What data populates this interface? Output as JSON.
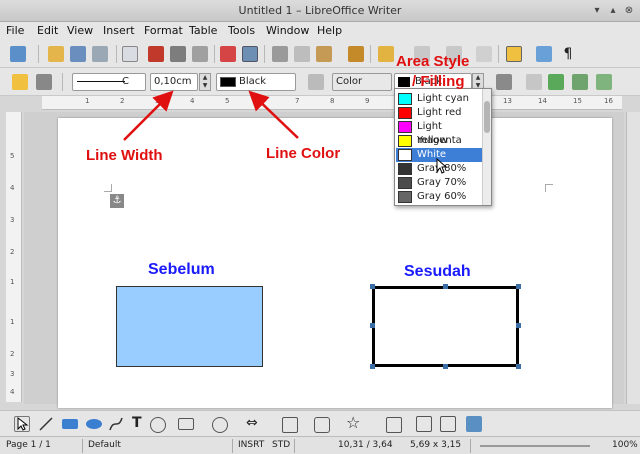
{
  "window": {
    "title": "Untitled 1 – LibreOffice Writer",
    "close_glyph": "⊗"
  },
  "menu": [
    "File",
    "Edit",
    "View",
    "Insert",
    "Format",
    "Table",
    "Tools",
    "Window",
    "Help"
  ],
  "line_toolbar": {
    "line_style_partial": "C",
    "line_width": "0,10cm",
    "line_color": "Black",
    "line_color_swatch": "#000000",
    "area_style": "Color",
    "area_fill": "Black"
  },
  "area_fill_dropdown": {
    "items": [
      {
        "label": "Light cyan",
        "color": "#00ffff"
      },
      {
        "label": "Light red",
        "color": "#ff0000"
      },
      {
        "label": "Light magenta",
        "color": "#ff00ff"
      },
      {
        "label": "Yellow",
        "color": "#ffff00"
      },
      {
        "label": "White",
        "color": "#ffffff",
        "selected": true
      },
      {
        "label": "Gray 80%",
        "color": "#333333"
      },
      {
        "label": "Gray 70%",
        "color": "#4c4c4c"
      },
      {
        "label": "Gray 60%",
        "color": "#666666"
      }
    ]
  },
  "ruler": {
    "top_ticks": [
      "1",
      "2",
      "3",
      "4",
      "5",
      "6",
      "7",
      "8",
      "9",
      "10",
      "11",
      "12",
      "13",
      "14",
      "15",
      "16"
    ],
    "left_ticks": [
      "5",
      "4",
      "3",
      "2",
      "1",
      "1",
      "2",
      "3",
      "4"
    ]
  },
  "annotations": {
    "line_width": "Line Width",
    "line_color": "Line Color",
    "area_style_line1": "Area Style",
    "area_style_line2": "/ Filling"
  },
  "document": {
    "heading_left": "Sebelum",
    "heading_right": "Sesudah",
    "rect_before_fill": "#99ccff",
    "rect_after_fill": "#ffffff",
    "anchor_glyph": "⚓"
  },
  "draw_toolbar": {
    "text_tool": "T"
  },
  "status": {
    "page": "Page 1 / 1",
    "style": "Default",
    "insert_mode": "INSRT",
    "selection_mode": "STD",
    "position": "10,31 / 3,64",
    "size": "5,69 x 3,15",
    "zoom": "100%"
  },
  "colors": {
    "annotation": "#e01010",
    "heading": "#1a1aff",
    "selection": "#3d7fd6"
  }
}
